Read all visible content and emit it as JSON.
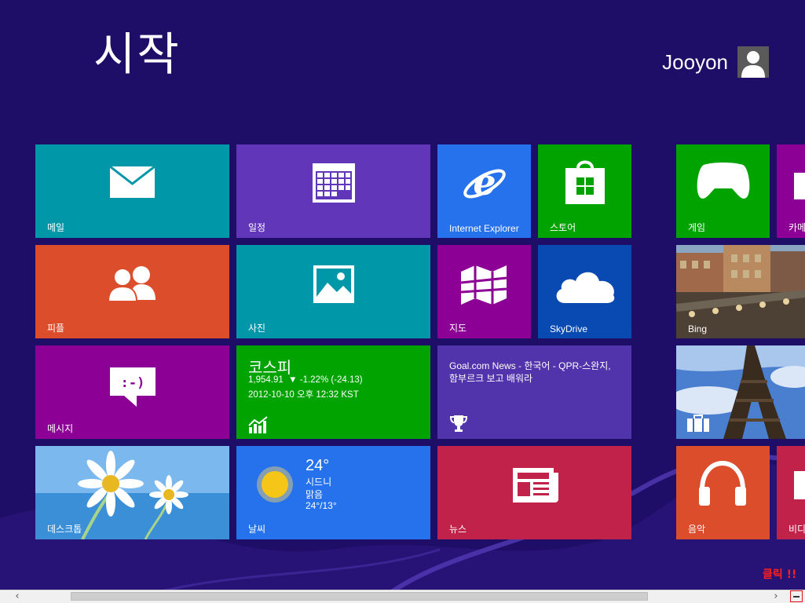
{
  "screen": {
    "title": "시작",
    "user": {
      "name": "Jooyon"
    },
    "annotation": "클릭 !!"
  },
  "tiles": {
    "mail": {
      "label": "메일",
      "color": "#0097a8"
    },
    "calendar": {
      "label": "일정",
      "color": "#6236b8"
    },
    "ie": {
      "label": "Internet Explorer",
      "color": "#2672ec"
    },
    "store": {
      "label": "스토어",
      "color": "#00a300"
    },
    "games": {
      "label": "게임",
      "color": "#00a300"
    },
    "camera": {
      "label": "카메",
      "color": "#8c0095"
    },
    "people": {
      "label": "피플",
      "color": "#dc4d2c"
    },
    "photos": {
      "label": "사진",
      "color": "#0097a8"
    },
    "maps": {
      "label": "지도",
      "color": "#8c0095"
    },
    "skydrive": {
      "label": "SkyDrive",
      "color": "#094ab2"
    },
    "bing": {
      "label": "Bing"
    },
    "messaging": {
      "label": "메시지",
      "color": "#8c0095"
    },
    "finance": {
      "title": "코스피",
      "quote": "1,954.91",
      "change": "▼ -1.22% (-24.13)",
      "timestamp": "2012-10-10 오후 12:32 KST",
      "color": "#00a300"
    },
    "sports": {
      "headline": "Goal.com News - 한국어 - QPR-스완지, 함부르크 보고 배워라",
      "color": "#5133ab"
    },
    "desktop": {
      "label": "데스크톱"
    },
    "weather": {
      "label": "날씨",
      "temp": "24°",
      "city": "시드니",
      "condition": "맑음",
      "range": "24°/13°",
      "color": "#2672ec"
    },
    "news": {
      "label": "뉴스",
      "color": "#c1224a"
    },
    "music": {
      "label": "음악",
      "color": "#dc4d2c"
    },
    "video": {
      "label": "비디",
      "color": "#c1224a"
    }
  },
  "icons": {
    "mail": "mail-icon",
    "calendar": "calendar-icon",
    "ie": "ie-icon",
    "store": "store-icon",
    "games": "gamepad-icon",
    "people": "people-icon",
    "photos": "photo-icon",
    "maps": "map-icon",
    "skydrive": "cloud-icon",
    "messaging": "message-bubble-icon",
    "finance": "chart-icon",
    "sports": "trophy-icon",
    "weather": "sun-icon",
    "news": "newspaper-icon",
    "music": "headphones-icon"
  },
  "scrollbar": {
    "left_arrow": "‹",
    "right_arrow": "›"
  }
}
